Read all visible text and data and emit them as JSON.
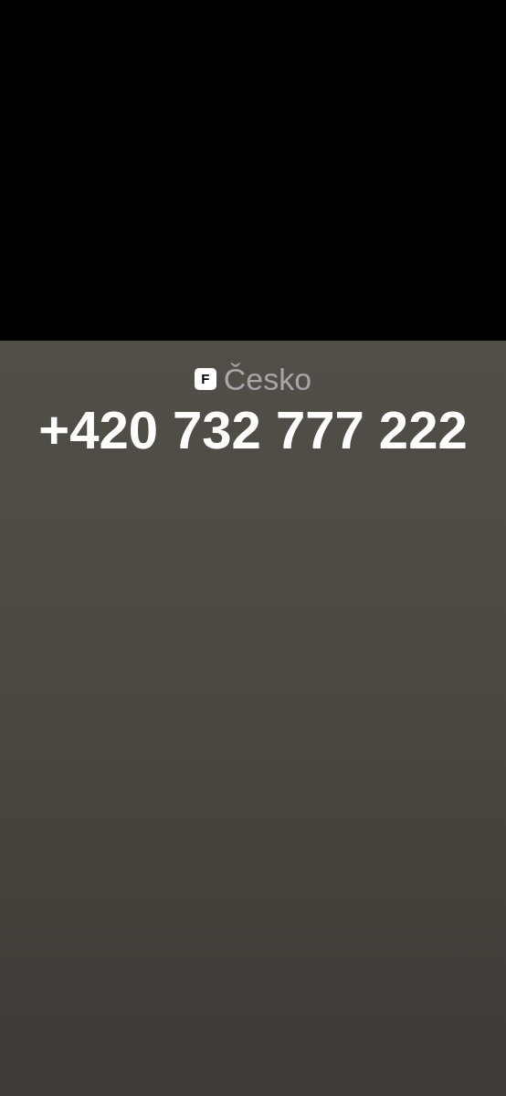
{
  "call": {
    "label_badge": "F",
    "label": "Česko",
    "number": "+420 732 777 222"
  }
}
